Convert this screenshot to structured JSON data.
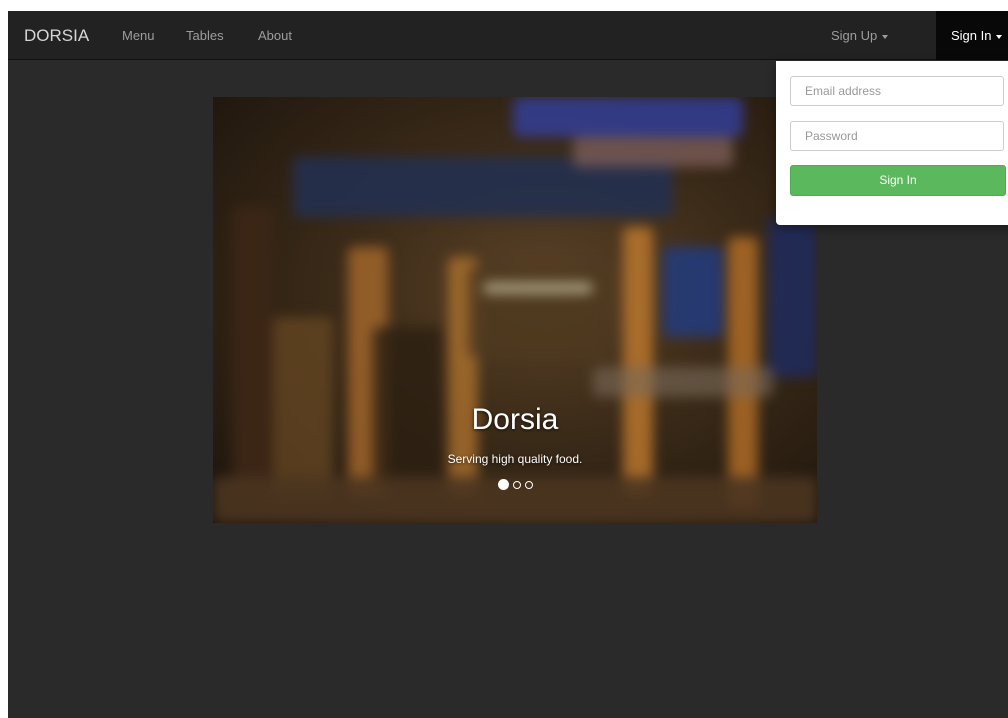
{
  "navbar": {
    "brand": "DORSIA",
    "links": [
      "Menu",
      "Tables",
      "About"
    ],
    "signup": "Sign Up",
    "signin": "Sign In"
  },
  "carousel": {
    "title": "Dorsia",
    "subtitle": "Serving high quality food.",
    "slide_count": 3,
    "active_index": 0
  },
  "signin_form": {
    "email_placeholder": "Email address",
    "password_placeholder": "Password",
    "submit_label": "Sign In"
  },
  "colors": {
    "navbar_bg": "#222222",
    "page_bg": "#2a2a2a",
    "submit_button": "#5cb85c"
  }
}
